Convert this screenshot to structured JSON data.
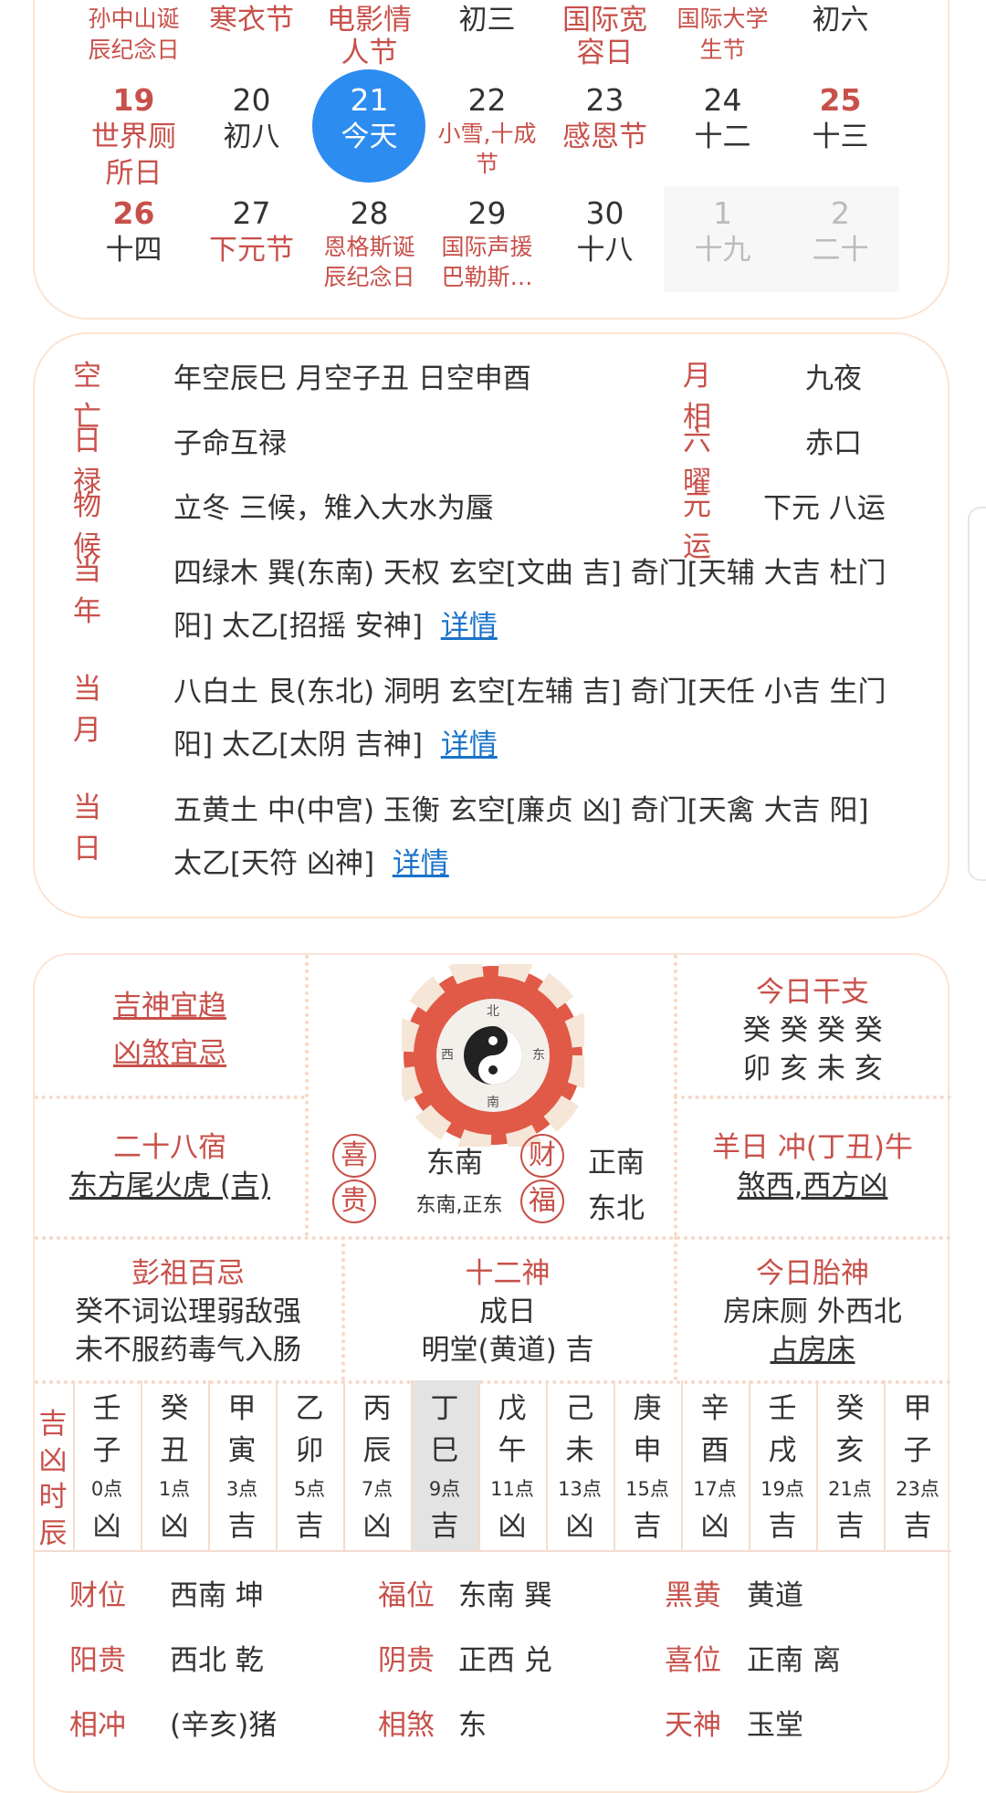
{
  "calendar": {
    "row0": [
      {
        "lines": [
          "孙中山诞",
          "辰纪念日"
        ],
        "red": true,
        "small": true
      },
      {
        "lines": [
          "寒衣节"
        ],
        "red": true
      },
      {
        "lines": [
          "电影情",
          "人节"
        ],
        "red": true
      },
      {
        "lines": [
          "初三"
        ],
        "red": false
      },
      {
        "lines": [
          "国际宽",
          "容日"
        ],
        "red": true
      },
      {
        "lines": [
          "国际大学",
          "生节"
        ],
        "red": true,
        "small": true
      },
      {
        "lines": [
          "初六"
        ],
        "red": false
      }
    ],
    "row1": [
      {
        "day": "19",
        "lunar": [
          "世界厕",
          "所日"
        ],
        "day_red": true,
        "lunar_red": true
      },
      {
        "day": "20",
        "lunar": [
          "初八"
        ],
        "day_red": false,
        "lunar_red": false
      },
      {
        "day": "21",
        "lunar": [
          "今天"
        ],
        "today": true
      },
      {
        "day": "22",
        "lunar": [
          "小雪,十成",
          "节"
        ],
        "day_red": false,
        "lunar_red": true,
        "small": true
      },
      {
        "day": "23",
        "lunar": [
          "感恩节"
        ],
        "day_red": false,
        "lunar_red": true
      },
      {
        "day": "24",
        "lunar": [
          "十二"
        ],
        "day_red": false,
        "lunar_red": false
      },
      {
        "day": "25",
        "lunar": [
          "十三"
        ],
        "day_red": true,
        "lunar_red": false
      }
    ],
    "row2": [
      {
        "day": "26",
        "lunar": [
          "十四"
        ],
        "day_red": true,
        "lunar_red": false
      },
      {
        "day": "27",
        "lunar": [
          "下元节"
        ],
        "day_red": false,
        "lunar_red": true
      },
      {
        "day": "28",
        "lunar": [
          "恩格斯诞",
          "辰纪念日"
        ],
        "day_red": false,
        "lunar_red": true,
        "small": true
      },
      {
        "day": "29",
        "lunar": [
          "国际声援",
          "巴勒斯…"
        ],
        "day_red": false,
        "lunar_red": true,
        "small": true
      },
      {
        "day": "30",
        "lunar": [
          "十八"
        ],
        "day_red": false,
        "lunar_red": false
      },
      {
        "day": "1",
        "lunar": [
          "十九"
        ],
        "grey": true
      },
      {
        "day": "2",
        "lunar": [
          "二十"
        ],
        "grey": true
      }
    ]
  },
  "info": {
    "kongwang_label": "空亡",
    "kongwang_val": "年空辰巳 月空子丑 日空申酉",
    "yuexiang_label": "月相",
    "yuexiang_val": "九夜",
    "rilu_label": "日禄",
    "rilu_val": "子命互禄",
    "liuyao_label": "六曜",
    "liuyao_val": "赤口",
    "wuhou_label": "物候",
    "wuhou_val": "立冬 三候，雉入大水为蜃",
    "yuanyun_label": "元运",
    "yuanyun_val": "下元 八运",
    "year_label": "当年",
    "year_val1": "四绿木 巽(东南) 天权 玄空[文曲 吉] 奇门[天辅 大吉 杜门",
    "year_val2": "阳] 太乙[招摇 安神]",
    "month_label": "当月",
    "month_val1": "八白土 艮(东北) 洞明 玄空[左辅 吉] 奇门[天任 小吉 生门",
    "month_val2": "阳] 太乙[太阴 吉神]",
    "day_label": "当日",
    "day_val1": "五黄土 中(中宫) 玉衡 玄空[廉贞 凶] 奇门[天禽 大吉 阳]",
    "day_val2": "太乙[天符 凶神]",
    "detail_link": "详情"
  },
  "grid": {
    "jishen": "吉神宜趋",
    "xiongsha": "凶煞宜忌",
    "ganzhi_title": "今日干支",
    "ganzhi_top": "癸 癸 癸 癸",
    "ganzhi_bottom": "卯 亥 未 亥",
    "xiu_title": "二十八宿",
    "xiu_val": "东方尾火虎 (吉)",
    "xi_seal": "喜",
    "xi_dir": "东南",
    "cai_seal": "财",
    "cai_dir": "正南",
    "gui_seal": "贵",
    "gui_dir": "东南,正东",
    "fu_seal": "福",
    "fu_dir": "东北",
    "chong_title": "羊日 冲(丁丑)牛",
    "sha_val": "煞西,西方凶",
    "pengzu_title": "彭祖百忌",
    "pengzu_l1": "癸不词讼理弱敌强",
    "pengzu_l2": "未不服药毒气入肠",
    "shier_title": "十二神",
    "shier_l1": "成日",
    "shier_l2": "明堂(黄道) 吉",
    "taishen_title": "今日胎神",
    "taishen_l1": "房床厕 外西北",
    "taishen_l2": "占房床"
  },
  "hours": {
    "label": "吉凶时辰",
    "items": [
      {
        "g": "壬",
        "z": "子",
        "t": "0点",
        "r": "凶"
      },
      {
        "g": "癸",
        "z": "丑",
        "t": "1点",
        "r": "凶"
      },
      {
        "g": "甲",
        "z": "寅",
        "t": "3点",
        "r": "吉"
      },
      {
        "g": "乙",
        "z": "卯",
        "t": "5点",
        "r": "吉"
      },
      {
        "g": "丙",
        "z": "辰",
        "t": "7点",
        "r": "凶"
      },
      {
        "g": "丁",
        "z": "巳",
        "t": "9点",
        "r": "吉",
        "current": true
      },
      {
        "g": "戊",
        "z": "午",
        "t": "11点",
        "r": "凶"
      },
      {
        "g": "己",
        "z": "未",
        "t": "13点",
        "r": "凶"
      },
      {
        "g": "庚",
        "z": "申",
        "t": "15点",
        "r": "吉"
      },
      {
        "g": "辛",
        "z": "酉",
        "t": "17点",
        "r": "凶"
      },
      {
        "g": "壬",
        "z": "戌",
        "t": "19点",
        "r": "吉"
      },
      {
        "g": "癸",
        "z": "亥",
        "t": "21点",
        "r": "吉"
      },
      {
        "g": "甲",
        "z": "子",
        "t": "23点",
        "r": "吉"
      }
    ]
  },
  "bottom": {
    "caiwei_l": "财位",
    "caiwei_v": "西南 坤",
    "fuwei_l": "福位",
    "fuwei_v": "东南 巽",
    "heihuang_l": "黑黄",
    "heihuang_v": "黄道",
    "yanggui_l": "阳贵",
    "yanggui_v": "西北 乾",
    "yingui_l": "阴贵",
    "yingui_v": "正西 兑",
    "xiwei_l": "喜位",
    "xiwei_v": "正南 离",
    "xiangchong_l": "相冲",
    "xiangchong_v": "(辛亥)猪",
    "xiangsha_l": "相煞",
    "xiangsha_v": "东",
    "tianshen_l": "天神",
    "tianshen_v": "玉堂"
  },
  "colors": {
    "accent_red": "#c8504a",
    "today_blue": "#2d8cf0",
    "link_blue": "#1a73c9",
    "border_peach": "#fbe3d3"
  }
}
